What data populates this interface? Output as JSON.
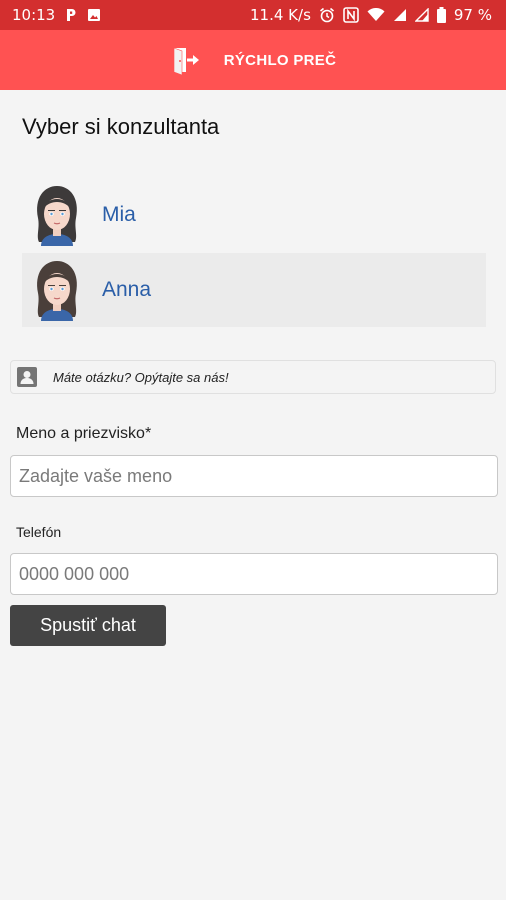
{
  "status_bar": {
    "time": "10:13",
    "network_speed": "11.4 K/s",
    "battery": "97 %",
    "icons": [
      "p-notification-icon",
      "image-notification-icon",
      "alarm-icon",
      "nfc-icon",
      "wifi-icon",
      "signal-icon",
      "signal-icon-2",
      "battery-icon"
    ]
  },
  "toolbar": {
    "exit_icon": "exit-door-icon",
    "title": "RÝCHLO PREČ",
    "color": "#ff5252"
  },
  "consultants_heading": "Vyber si konzultanta",
  "consultants": [
    {
      "name": "Mia",
      "selected": false
    },
    {
      "name": "Anna",
      "selected": true
    }
  ],
  "question_bar": {
    "icon": "contact-card-icon",
    "text": "Máte otázku? Opýtajte sa nás!"
  },
  "form": {
    "name_label": "Meno a priezvisko*",
    "name_placeholder": "Zadajte vaše meno",
    "phone_label": "Telefón",
    "phone_placeholder": "0000 000 000",
    "submit_label": "Spustiť chat"
  },
  "colors": {
    "status_bar": "#d32f2f",
    "toolbar": "#ff5252",
    "link": "#2a5ea8",
    "button": "#444444"
  }
}
